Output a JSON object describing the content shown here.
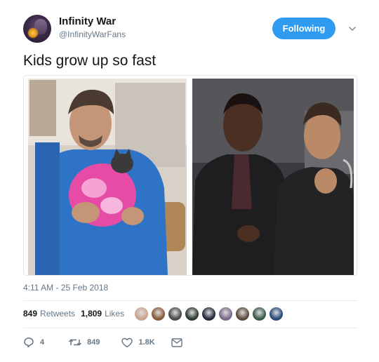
{
  "author": {
    "name": "Infinity War",
    "handle": "@InfinityWarFans",
    "avatar_icon": "avatar-icon"
  },
  "follow_button": {
    "label": "Following",
    "color": "#2e9bf0"
  },
  "tweet": {
    "text": "Kids grow up so fast",
    "timestamp": "4:11 AM - 25 Feb 2018"
  },
  "stats": {
    "retweets_count": "849",
    "retweets_label": "Retweets",
    "likes_count": "1,809",
    "likes_label": "Likes"
  },
  "likers": [
    {
      "color": "#c9a590"
    },
    {
      "color": "#8a5a3a"
    },
    {
      "color": "#4a4a4a"
    },
    {
      "color": "#2f3a2f"
    },
    {
      "color": "#232a3a"
    },
    {
      "color": "#7a6a8a"
    },
    {
      "color": "#5a4a3a"
    },
    {
      "color": "#3a5a4a"
    },
    {
      "color": "#2a4a7a"
    }
  ],
  "actions": {
    "reply_count": "4",
    "retweet_count": "849",
    "like_count": "1.8K"
  },
  "colors": {
    "accent": "#1da1f2",
    "muted": "#657786",
    "text": "#14171a",
    "border": "#e6ecf0"
  }
}
